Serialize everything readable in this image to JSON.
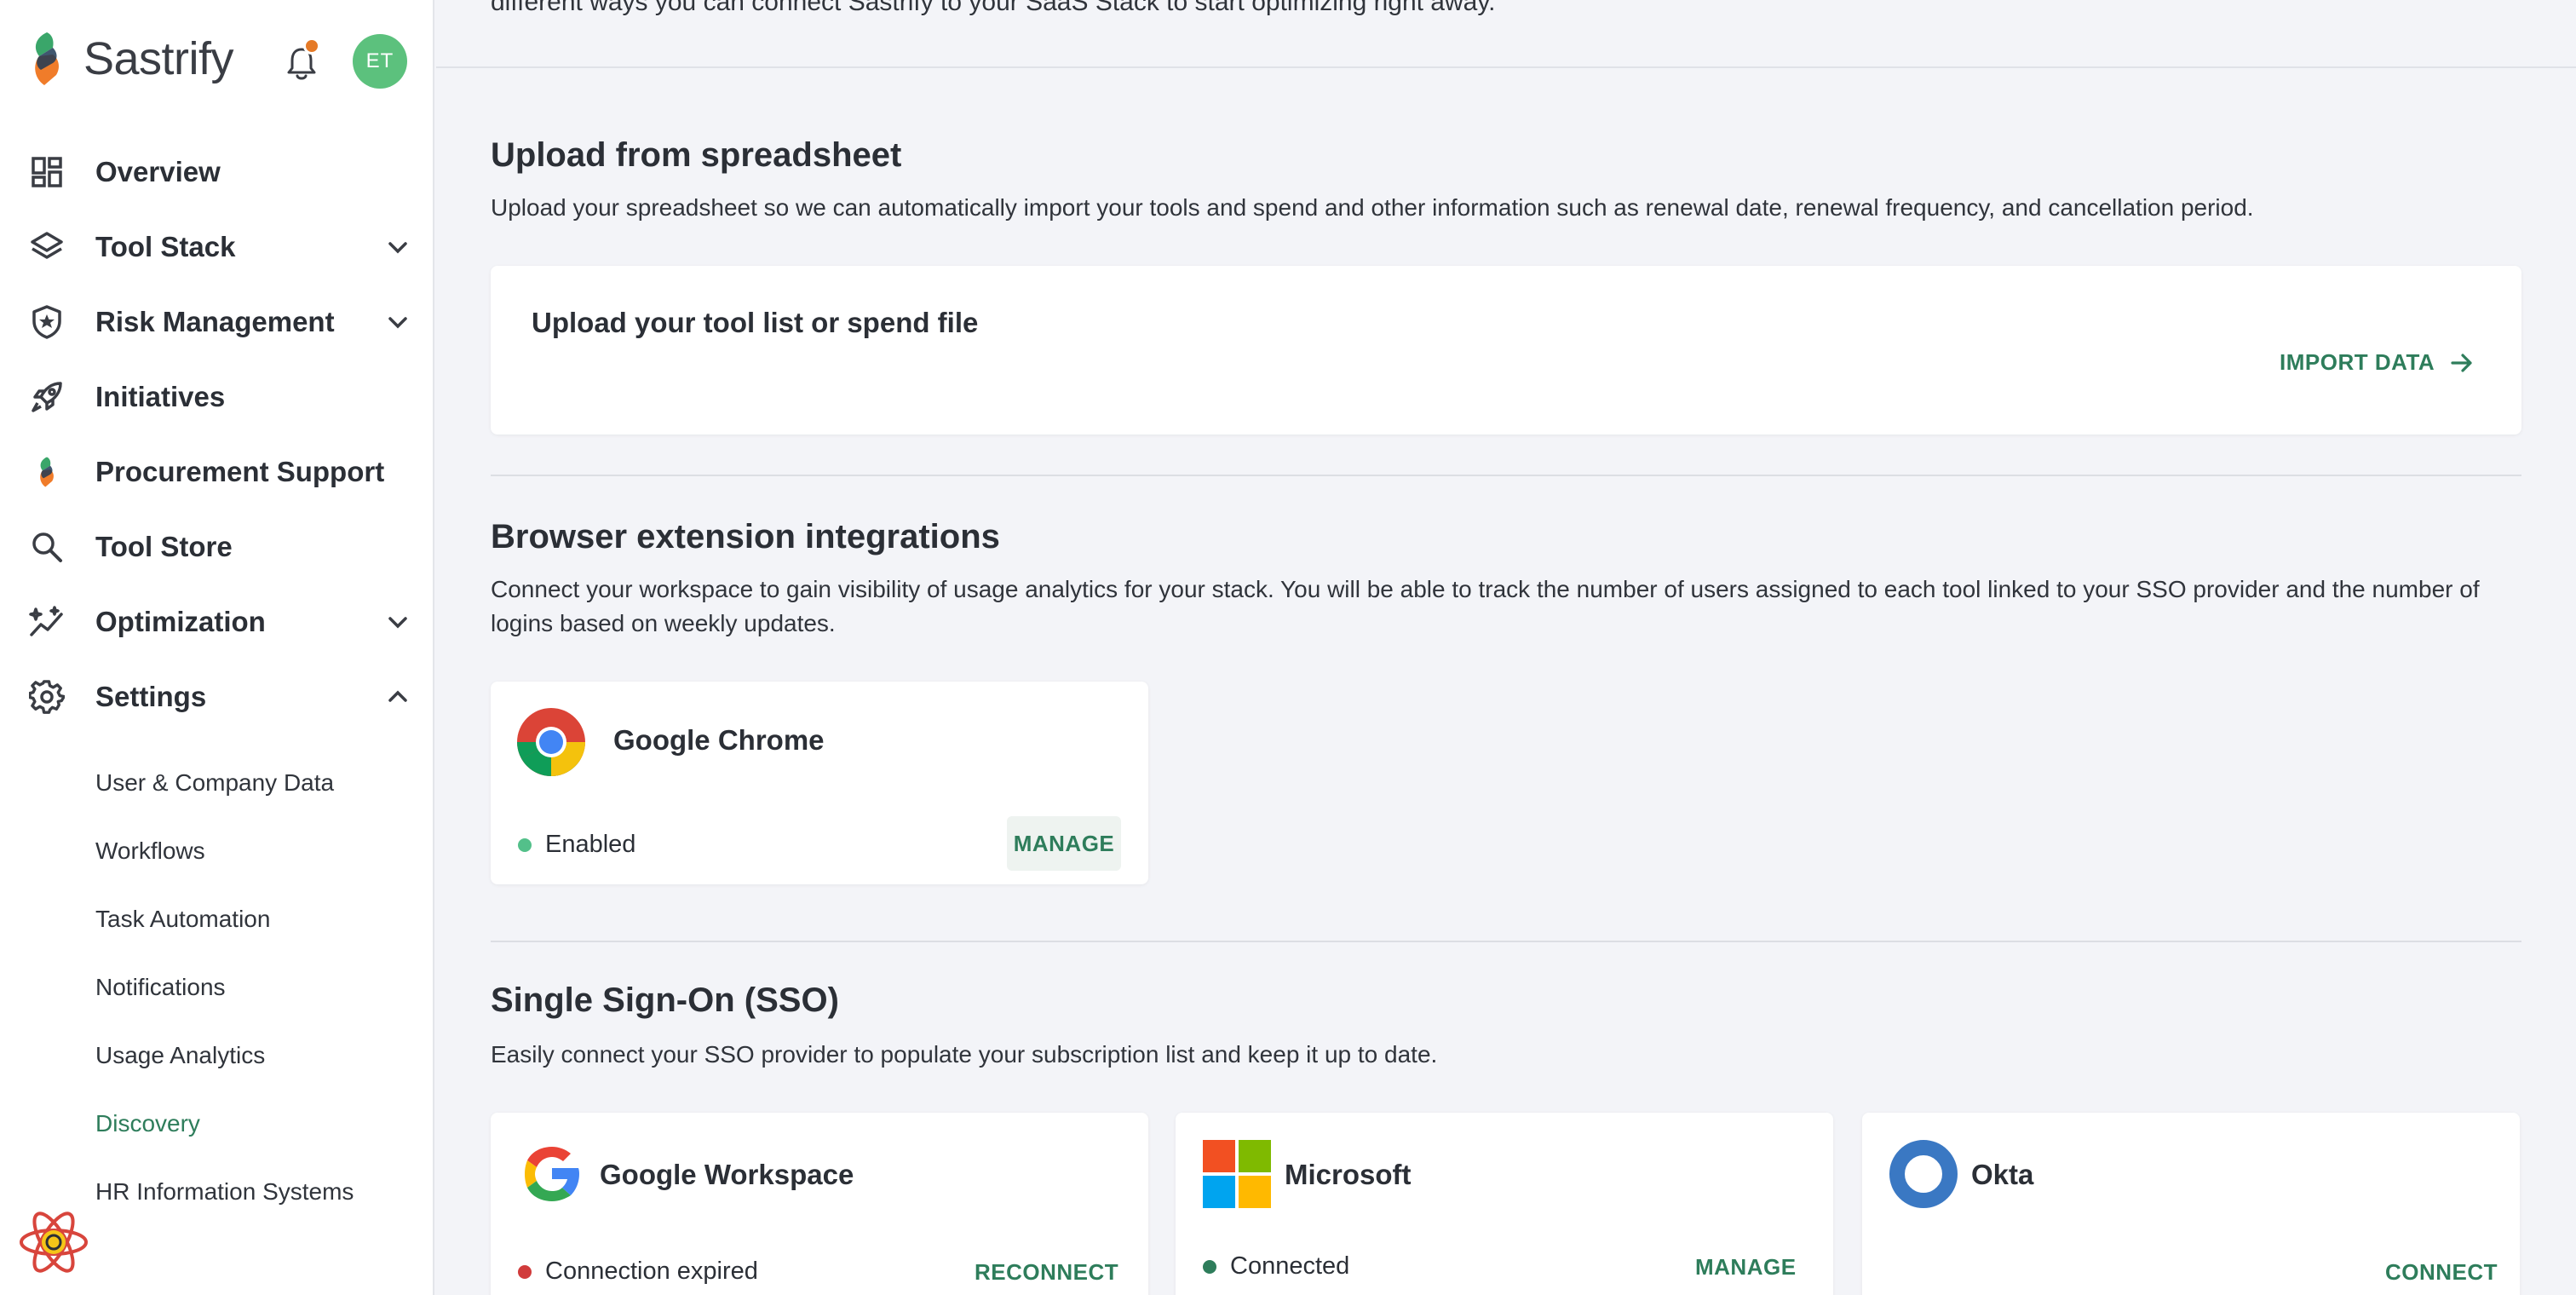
{
  "brand": {
    "name": "Sastrify"
  },
  "user": {
    "initials": "ET"
  },
  "colors": {
    "accent": "#2e7d5b",
    "enabled": "#53c08a",
    "expired": "#d13b3b",
    "connected": "#2e7d5b",
    "avatar": "#5cc17d",
    "notification": "#e57a27"
  },
  "nav": {
    "items": [
      {
        "label": "Overview",
        "icon": "dashboard-icon"
      },
      {
        "label": "Tool Stack",
        "icon": "layers-icon",
        "chevron": "down"
      },
      {
        "label": "Risk Management",
        "icon": "shield-icon",
        "chevron": "down"
      },
      {
        "label": "Initiatives",
        "icon": "rocket-icon"
      },
      {
        "label": "Procurement Support",
        "icon": "sastrify-logo-icon"
      },
      {
        "label": "Tool Store",
        "icon": "search-icon"
      },
      {
        "label": "Optimization",
        "icon": "sparkle-chart-icon",
        "chevron": "down"
      },
      {
        "label": "Settings",
        "icon": "gear-icon",
        "chevron": "up"
      }
    ],
    "settings_sub": [
      {
        "label": "User & Company Data"
      },
      {
        "label": "Workflows"
      },
      {
        "label": "Task Automation"
      },
      {
        "label": "Notifications"
      },
      {
        "label": "Usage Analytics"
      },
      {
        "label": "Discovery",
        "active": true
      },
      {
        "label": "HR Information Systems"
      }
    ]
  },
  "main": {
    "intro": "different ways you can connect Sastrify to your SaaS Stack to start optimizing right away.",
    "upload": {
      "title": "Upload from spreadsheet",
      "desc": "Upload your spreadsheet so we can automatically import your tools and spend and other information such as renewal date, renewal frequency, and cancellation period.",
      "card_title": "Upload your tool list or spend file",
      "action": "IMPORT DATA"
    },
    "browser": {
      "title": "Browser extension integrations",
      "desc": "Connect your workspace to gain visibility of usage analytics for your stack. You will be able to track the number of users assigned to each tool linked to your SSO provider and the number of logins based on weekly updates.",
      "chrome": {
        "name": "Google Chrome",
        "status": "Enabled",
        "action": "MANAGE"
      }
    },
    "sso": {
      "title": "Single Sign-On (SSO)",
      "desc": "Easily connect your SSO provider to populate your subscription list and keep it up to date.",
      "providers": [
        {
          "name": "Google Workspace",
          "status": "Connection expired",
          "action": "RECONNECT"
        },
        {
          "name": "Microsoft",
          "status": "Connected",
          "action": "MANAGE"
        },
        {
          "name": "Okta",
          "action": "CONNECT"
        }
      ]
    }
  }
}
